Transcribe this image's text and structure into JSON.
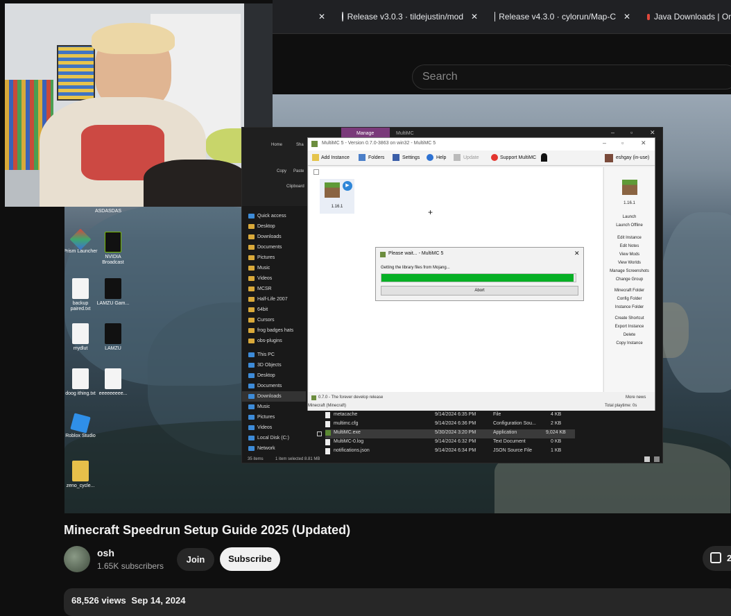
{
  "browser": {
    "tabs": [
      {
        "title": "Release v3.0.3 · tildejustin/mod"
      },
      {
        "title": "Release v4.3.0 · cylorun/Map-C"
      },
      {
        "title": "Java Downloads | Or"
      }
    ]
  },
  "youtube": {
    "search_placeholder": "Search",
    "video_title": "Minecraft Speedrun Setup Guide 2025 (Updated)",
    "channel_name": "osh",
    "subscribers": "1.65K subscribers",
    "join_label": "Join",
    "subscribe_label": "Subscribe",
    "like_count": "2",
    "views": "68,526 views",
    "date": "Sep 14, 2024"
  },
  "desktop": {
    "icons": [
      {
        "label": "ASDASDAS"
      },
      {
        "label": "Prism Launcher"
      },
      {
        "label": "NVIDIA Broadcast"
      },
      {
        "label": "backup paired.txt"
      },
      {
        "label": "LAMZU Gam..."
      },
      {
        "label": "mydlut"
      },
      {
        "label": "LAMZU"
      },
      {
        "label": "doog ithing.txt"
      },
      {
        "label": "eeeeeeeee..."
      },
      {
        "label": "Roblox Studio"
      },
      {
        "label": "zeno_cycle..."
      }
    ]
  },
  "explorer": {
    "ribbon_tab": "Manage",
    "ribbon_app": "MultiMC",
    "ribbon_left_tabs": [
      "Home",
      "Sha"
    ],
    "ribbon_btns": [
      "Copy",
      "Paste"
    ],
    "clipboard_label": "Clipboard",
    "quick_access_label": "Quick access",
    "nav_items": [
      "Desktop",
      "Downloads",
      "Documents",
      "Pictures",
      "Music",
      "Videos",
      "MCSR",
      "Half-Life 2007",
      "64bit",
      "Cursors",
      "frog badges hats",
      "obs-plugins"
    ],
    "this_pc_label": "This PC",
    "pc_items": [
      "3D Objects",
      "Desktop",
      "Documents",
      "Downloads",
      "Music",
      "Pictures",
      "Videos",
      "Local Disk (C:)"
    ],
    "network_label": "Network",
    "files": [
      {
        "name": "metacache",
        "date": "9/14/2024 6:35 PM",
        "type": "File",
        "size": "4 KB"
      },
      {
        "name": "multimc.cfg",
        "date": "9/14/2024 6:36 PM",
        "type": "Configuration Sou...",
        "size": "2 KB"
      },
      {
        "name": "MultiMC.exe",
        "date": "5/30/2024 3:20 PM",
        "type": "Application",
        "size": "9,024 KB"
      },
      {
        "name": "MultiMC-0.log",
        "date": "9/14/2024 6:32 PM",
        "type": "Text Document",
        "size": "0 KB"
      },
      {
        "name": "notifications.json",
        "date": "9/14/2024 6:34 PM",
        "type": "JSON Source File",
        "size": "1 KB"
      }
    ],
    "status_items": "35 items",
    "status_selected": "1 item selected  8.81 MB"
  },
  "multimc": {
    "title": "MultiMC 5 - Version 0.7.0-3863 on win32 - MultiMC 5",
    "toolbar": [
      "Add Instance",
      "Folders",
      "Settings",
      "Help",
      "Update",
      "Support MultiMC"
    ],
    "account": "eshgay (in-use)",
    "instance_name": "1.16.1",
    "side_instance": "1.16.1",
    "side_actions": [
      "Launch",
      "Launch Offline",
      "Edit Instance",
      "Edit Notes",
      "View Mods",
      "View Worlds",
      "Manage Screenshots",
      "Change Group",
      "Minecraft Folder",
      "Config Folder",
      "Instance Folder",
      "Create Shortcut",
      "Export Instance",
      "Delete",
      "Copy Instance"
    ],
    "status_left": "0.7.0 - The forever develop release",
    "status_news": "More news",
    "status_instance": "Minecraft (Minecraft)",
    "status_playtime": "Total playtime: 0s",
    "dialog_title": "Please wait... - MultiMC 5",
    "dialog_msg": "Getting the library files from Mojang...",
    "dialog_abort": "Abort",
    "progress": 0.99
  }
}
